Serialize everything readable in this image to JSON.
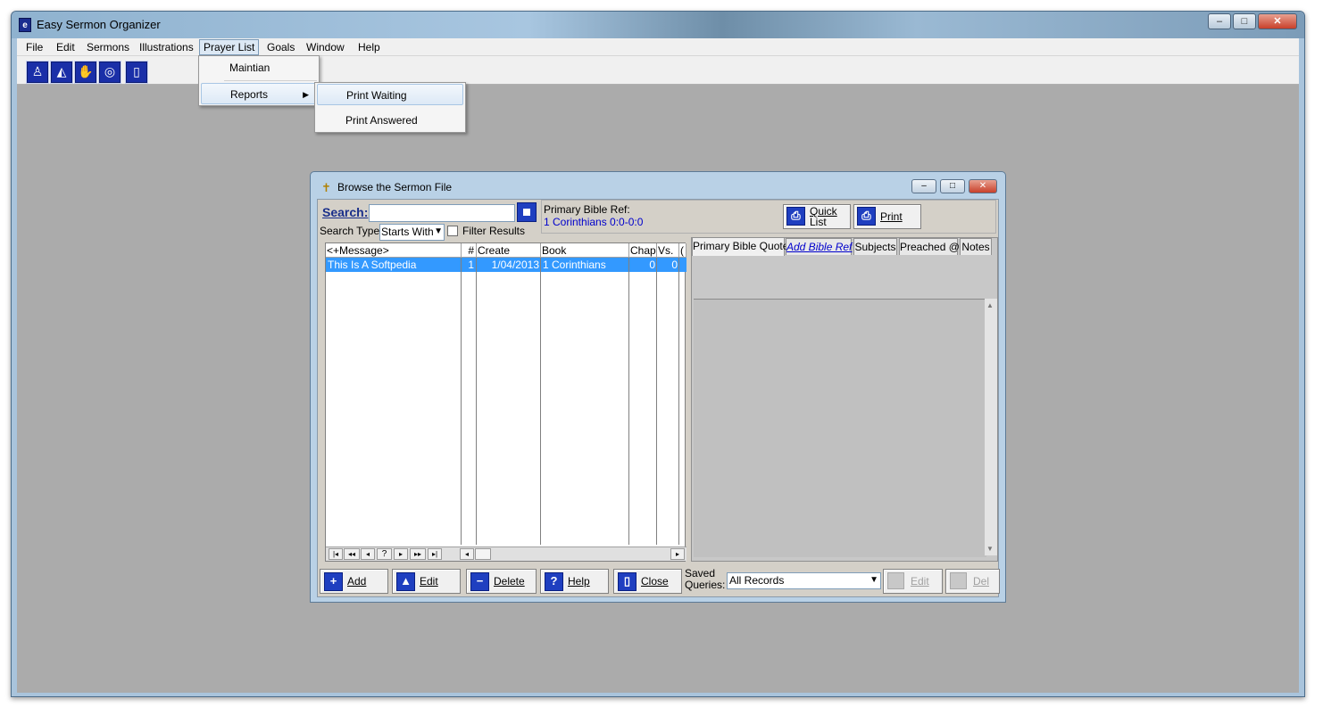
{
  "app": {
    "title": "Easy Sermon Organizer",
    "icon": "book-icon",
    "caption": {
      "minimize": "–",
      "maximize": "□",
      "close": "✕"
    }
  },
  "menu": {
    "file": "File",
    "edit": "Edit",
    "sermons": "Sermons",
    "illustrations": "Illustrations",
    "prayer_list": "Prayer List",
    "goals": "Goals",
    "window": "Window",
    "help": "Help"
  },
  "toolbar_icons": [
    "sermon-icon",
    "illustration-icon",
    "prayer-icon",
    "goals-icon",
    "exit-door-icon"
  ],
  "prayer_menu": {
    "maintian": "Maintian",
    "reports": "Reports",
    "submenu": {
      "print_waiting": "Print Waiting",
      "print_answered": "Print Answered"
    }
  },
  "browse": {
    "title": "Browse the Sermon File",
    "search_label": "Search:",
    "search_value": "",
    "search_type_label": "Search Type:",
    "search_type_value": "Starts With",
    "filter_label": "Filter Results",
    "primary_ref_label": "Primary Bible Ref:",
    "primary_ref_value": "1 Corinthians 0:0-0:0",
    "quick_list_1": "Quick",
    "quick_list_2": "List",
    "print": "Print",
    "columns": [
      "<+Message>",
      "#",
      "Create",
      "Book",
      "Chap",
      "Vs.",
      "("
    ],
    "rows": [
      {
        "message": "This Is A Softpedia",
        "num": "1",
        "create": "1/04/2013",
        "book": "1 Corinthians",
        "chap": "0",
        "vs": "0"
      }
    ],
    "nav": [
      "|◂",
      "◂◂",
      "◂",
      "?",
      "▸",
      "▸▸",
      "▸|"
    ],
    "tabs": [
      "Primary Bible Quote",
      "Add Bible Ref",
      "Subjects",
      "Preached @",
      "Notes"
    ],
    "buttons": {
      "add": "Add",
      "edit": "Edit",
      "delete": "Delete",
      "help": "Help",
      "close": "Close"
    },
    "saved_queries_1": "Saved",
    "saved_queries_2": "Queries:",
    "saved_query_value": "All Records",
    "query_edit": "Edit",
    "query_del": "Del"
  },
  "colors": {
    "selection": "#3399ff",
    "mdi_background": "#ababab",
    "link_blue": "#0000cc"
  }
}
